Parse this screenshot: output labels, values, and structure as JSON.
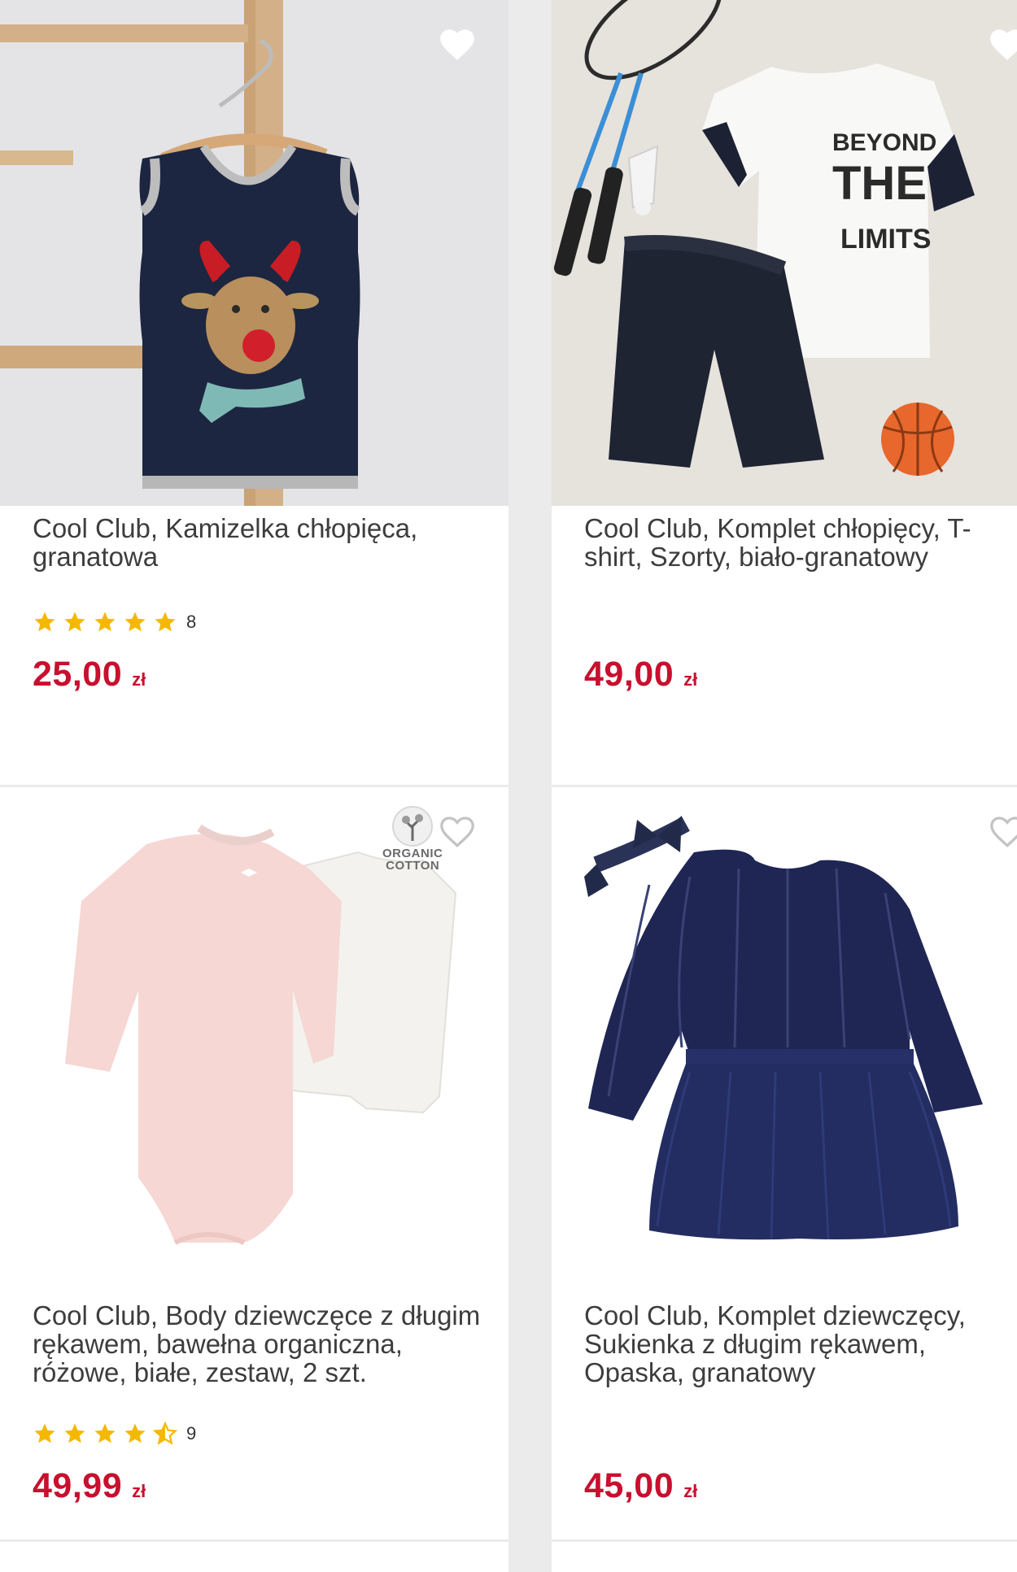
{
  "products": [
    {
      "title": "Cool Club, Kamizelka chłopięca, granatowa",
      "rating_stars": 5,
      "rating_count": "8",
      "price": "25,00",
      "currency": "zł",
      "image_icon": "knit-vest-reindeer-image"
    },
    {
      "title": "Cool Club, Komplet chłopięcy, T-shirt, Szorty, biało-granatowy",
      "price": "49,00",
      "currency": "zł",
      "image_icon": "tshirt-shorts-set-image",
      "image_text": [
        "BEYOND",
        "THE",
        "LIMITS"
      ]
    },
    {
      "title": "Cool Club, Body dziewczęce z długim rękawem, bawełna organiczna, różowe, białe, zestaw, 2 szt.",
      "rating_stars": 4.5,
      "rating_count": "9",
      "price": "49,99",
      "currency": "zł",
      "image_icon": "baby-bodysuits-image",
      "badge": [
        "ORGANIC",
        "COTTON"
      ]
    },
    {
      "title": "Cool Club, Komplet dziewczęcy, Sukienka z długim rękawem, Opaska, granatowy",
      "price": "45,00",
      "currency": "zł",
      "image_icon": "velvet-dress-headband-image"
    }
  ],
  "colors": {
    "price": "#c8102e",
    "star": "#f5b800",
    "background": "#ebebeb",
    "card": "#ffffff"
  }
}
